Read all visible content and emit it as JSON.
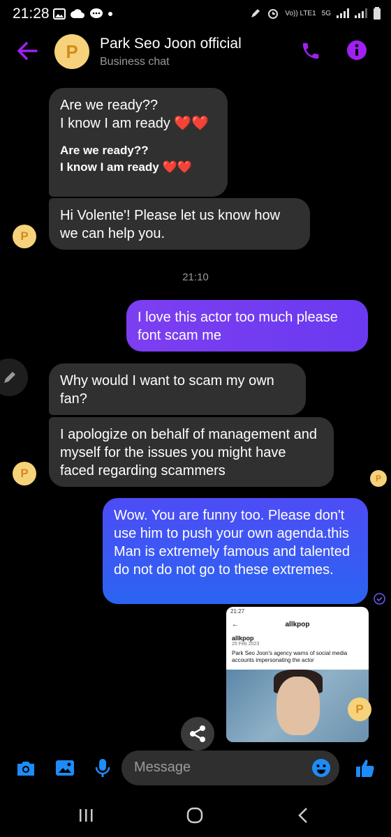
{
  "status_bar": {
    "time": "21:28",
    "network": "Vo)) LTE1",
    "network_type": "5G"
  },
  "header": {
    "avatar_letter": "P",
    "title": "Park Seo Joon official",
    "subtitle": "Business chat"
  },
  "messages": {
    "m1_line1": "Are we ready??",
    "m1_line2": "I know I am ready ❤️❤️",
    "m1_quote_line1": "Are we ready??",
    "m1_quote_line2": "I know I am ready ❤️❤️",
    "m2": "Hi Volente'! Please let us know how we can help you.",
    "timestamp": "21:10",
    "m3": "I love this actor too much please font scam me",
    "m4": "Why would I want to scam my own fan?",
    "m5": "I apologize on behalf of management and myself for the issues you might have faced regarding scammers",
    "m6": "Wow. You are funny too. Please don't use him to push your own agenda.this Man is extremely famous and talented do not do not go to these extremes."
  },
  "avatar_letter": "P",
  "screenshot_attachment": {
    "status_time": "21:27",
    "title": "allkpop",
    "source": "allkpop",
    "date": "25 Feb 2023",
    "headline": "Park Seo Joon's agency warns of social media accounts impersonating the actor"
  },
  "composer": {
    "placeholder": "Message"
  },
  "colors": {
    "accent_purple": "#a020f0",
    "outgoing_purple": "#7d3ef1",
    "outgoing_blue": "#2b64f2",
    "incoming_bubble": "#303030",
    "avatar_yellow": "#f6d27a",
    "blue_icons": "#1d8cf8"
  },
  "icons": [
    "back-arrow-icon",
    "phone-icon",
    "info-icon",
    "edit-icon",
    "share-icon",
    "camera-icon",
    "gallery-icon",
    "microphone-icon",
    "emoji-icon",
    "thumbs-up-icon",
    "recent-apps-icon",
    "home-icon",
    "back-icon"
  ]
}
